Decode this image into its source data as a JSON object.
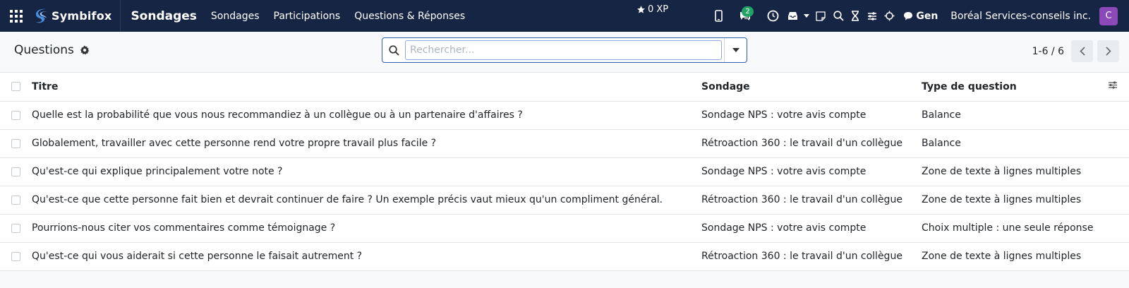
{
  "topbar": {
    "brand": "Symbifox",
    "app_name": "Sondages",
    "menu": [
      "Sondages",
      "Participations",
      "Questions & Réponses"
    ],
    "xp": "0 XP",
    "messages_count": "2",
    "user_short": "Gen",
    "company": "Boréal Services-conseils inc.",
    "avatar_letter": "C"
  },
  "control": {
    "breadcrumb": "Questions",
    "search_placeholder": "Rechercher...",
    "pager": "1-6 / 6"
  },
  "table": {
    "headers": {
      "title": "Titre",
      "survey": "Sondage",
      "type": "Type de question"
    },
    "rows": [
      {
        "title": "Quelle est la probabilité que vous nous recommandiez à un collègue ou à un partenaire d'affaires ?",
        "survey": "Sondage NPS : votre avis compte",
        "type": "Balance"
      },
      {
        "title": "Globalement, travailler avec cette personne rend votre propre travail plus facile ?",
        "survey": "Rétroaction 360 : le travail d'un collègue",
        "type": "Balance"
      },
      {
        "title": "Qu'est-ce qui explique principalement votre note ?",
        "survey": "Sondage NPS : votre avis compte",
        "type": "Zone de texte à lignes multiples"
      },
      {
        "title": "Qu'est-ce que cette personne fait bien et devrait continuer de faire ? Un exemple précis vaut mieux qu'un compliment général.",
        "survey": "Rétroaction 360 : le travail d'un collègue",
        "type": "Zone de texte à lignes multiples"
      },
      {
        "title": "Pourrions-nous citer vos commentaires comme témoignage ?",
        "survey": "Sondage NPS : votre avis compte",
        "type": "Choix multiple : une seule réponse"
      },
      {
        "title": "Qu'est-ce qui vous aiderait si cette personne le faisait autrement ?",
        "survey": "Rétroaction 360 : le travail d'un collègue",
        "type": "Zone de texte à lignes multiples"
      }
    ]
  },
  "colors": {
    "topbar": "#172544",
    "accent": "#2f5fb0",
    "badge": "#21a366",
    "avatar": "#8b48b8"
  }
}
